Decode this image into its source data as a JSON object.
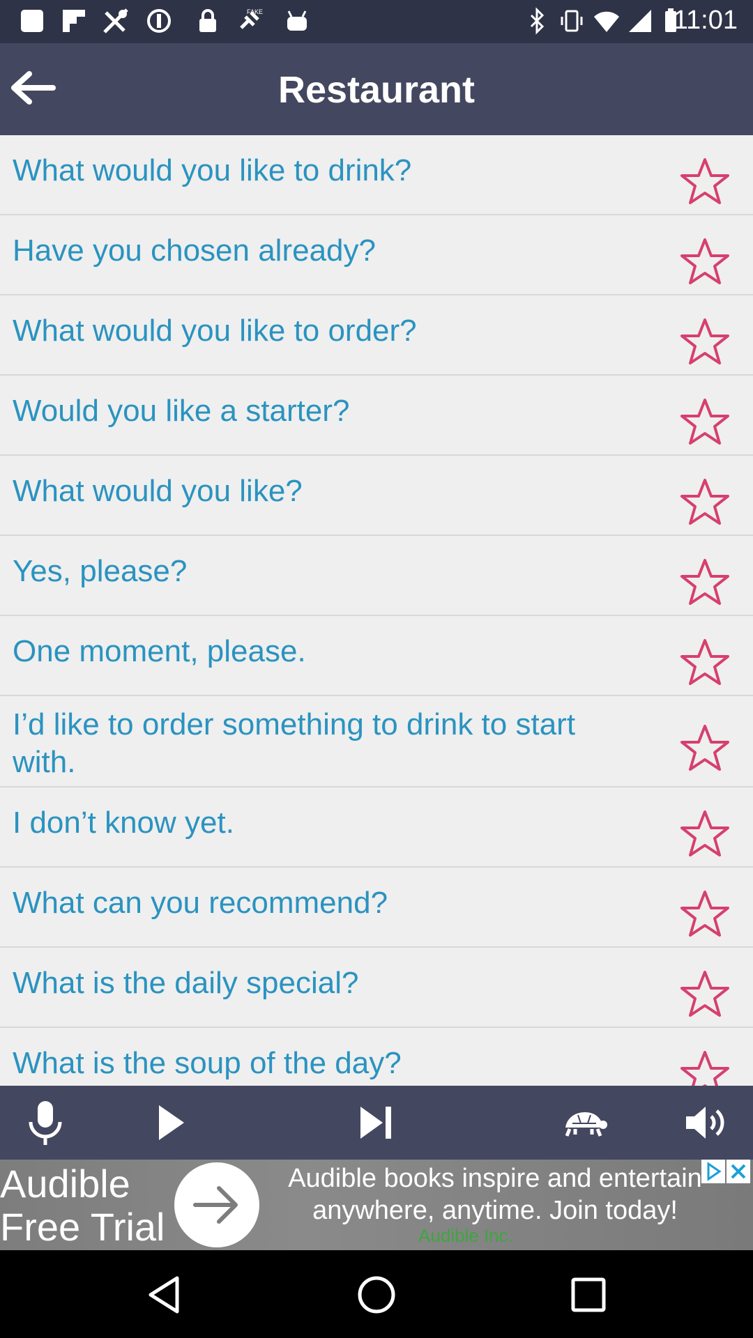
{
  "status_bar": {
    "time": "11:01",
    "left_icons": [
      "square-icon",
      "flipboard-icon",
      "maps-icon",
      "data-saver-icon",
      "lock-icon",
      "fake-gps-icon",
      "android-icon"
    ],
    "right_icons": [
      "bluetooth-icon",
      "vibrate-icon",
      "wifi-icon",
      "signal-icon",
      "battery-icon"
    ]
  },
  "header": {
    "title": "Restaurant",
    "back_icon": "arrow-left-icon",
    "background": "#444760"
  },
  "phrases": [
    {
      "text": "What would you like to drink?"
    },
    {
      "text": "Have you chosen already?"
    },
    {
      "text": "What would you like to order?"
    },
    {
      "text": "Would you like a starter?"
    },
    {
      "text": "What would you like?"
    },
    {
      "text": "Yes, please?"
    },
    {
      "text": "One moment, please."
    },
    {
      "text": "I’d like to order something to drink to start with."
    },
    {
      "text": "I don’t know yet."
    },
    {
      "text": "What can you recommend?"
    },
    {
      "text": "What is the daily special?"
    },
    {
      "text": "What is the soup of the day?"
    }
  ],
  "colors": {
    "phrase_text": "#2a93c0",
    "star_outline": "#d6406e",
    "toolbar": "#444760",
    "status_bar": "#2f3347"
  },
  "toolbar": {
    "buttons": [
      "microphone-icon",
      "play-icon",
      "skip-next-icon",
      "turtle-icon",
      "volume-icon"
    ]
  },
  "ad": {
    "brand": "Audible\nFree Trial",
    "description": "Audible books inspire and entertain\nanywhere, anytime. Join today!",
    "advertiser": "Audible Inc."
  },
  "nav_bar": {
    "buttons": [
      "back-triangle-icon",
      "home-circle-icon",
      "recents-square-icon"
    ]
  }
}
